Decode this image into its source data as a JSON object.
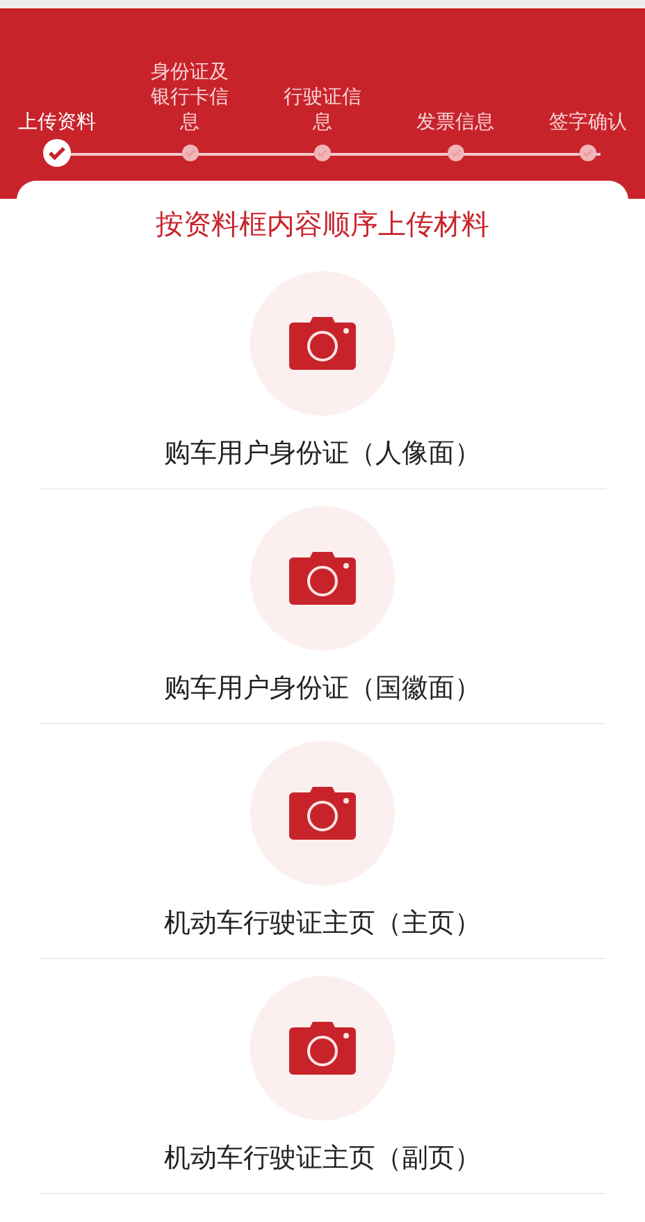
{
  "steps": [
    {
      "label": "上传资料",
      "selected": true
    },
    {
      "label": "身份证及银行卡信息",
      "selected": false
    },
    {
      "label": "行驶证信息",
      "selected": false
    },
    {
      "label": "发票信息",
      "selected": false
    },
    {
      "label": "签字确认",
      "selected": false
    }
  ],
  "card": {
    "title": "按资料框内容顺序上传材料",
    "uploads": [
      {
        "label": "购车用户身份证（人像面）"
      },
      {
        "label": "购车用户身份证（国徽面）"
      },
      {
        "label": "机动车行驶证主页（主页）"
      },
      {
        "label": "机动车行驶证主页（副页）"
      }
    ]
  }
}
